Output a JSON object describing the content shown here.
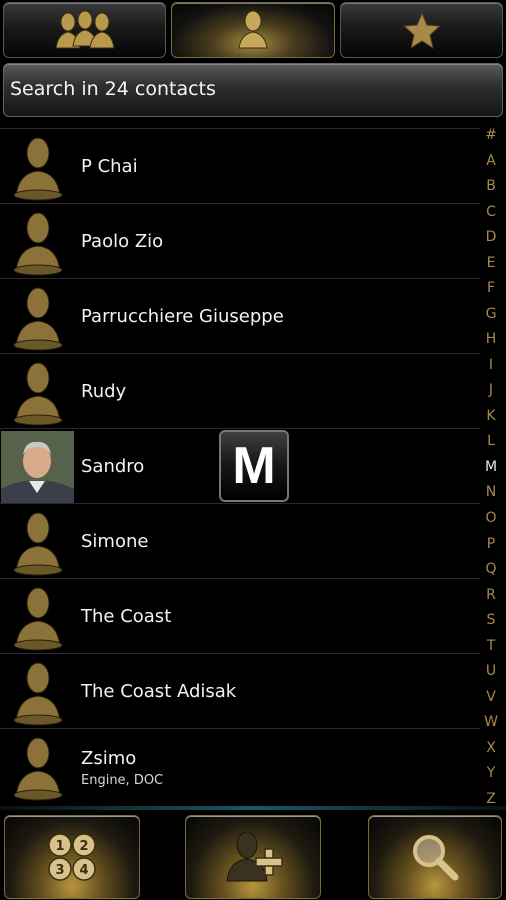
{
  "tabs": [
    {
      "icon": "groups-icon"
    },
    {
      "icon": "contact-icon"
    },
    {
      "icon": "star-icon"
    }
  ],
  "search": {
    "placeholder": "Search in 24 contacts"
  },
  "contacts": [
    {
      "name": "P Chai"
    },
    {
      "name": "Paolo Zio"
    },
    {
      "name": "Parrucchiere Giuseppe"
    },
    {
      "name": "Rudy"
    },
    {
      "name": "Sandro"
    },
    {
      "name": "Simone"
    },
    {
      "name": "The Coast"
    },
    {
      "name": "The Coast Adisak"
    },
    {
      "name": "Zsimo",
      "subtitle": "Engine, DOC"
    }
  ],
  "index": [
    "#",
    "A",
    "B",
    "C",
    "D",
    "E",
    "F",
    "G",
    "H",
    "I",
    "J",
    "K",
    "L",
    "M",
    "N",
    "O",
    "P",
    "Q",
    "R",
    "S",
    "T",
    "U",
    "V",
    "W",
    "X",
    "Y",
    "Z"
  ],
  "index_active": "M",
  "popup_letter": "M",
  "bottom_buttons": [
    {
      "icon": "dialpad-icon"
    },
    {
      "icon": "add-contact-icon"
    },
    {
      "icon": "search-icon"
    }
  ],
  "colors": {
    "accent_gold": "#a8894a",
    "background": "#000000"
  }
}
